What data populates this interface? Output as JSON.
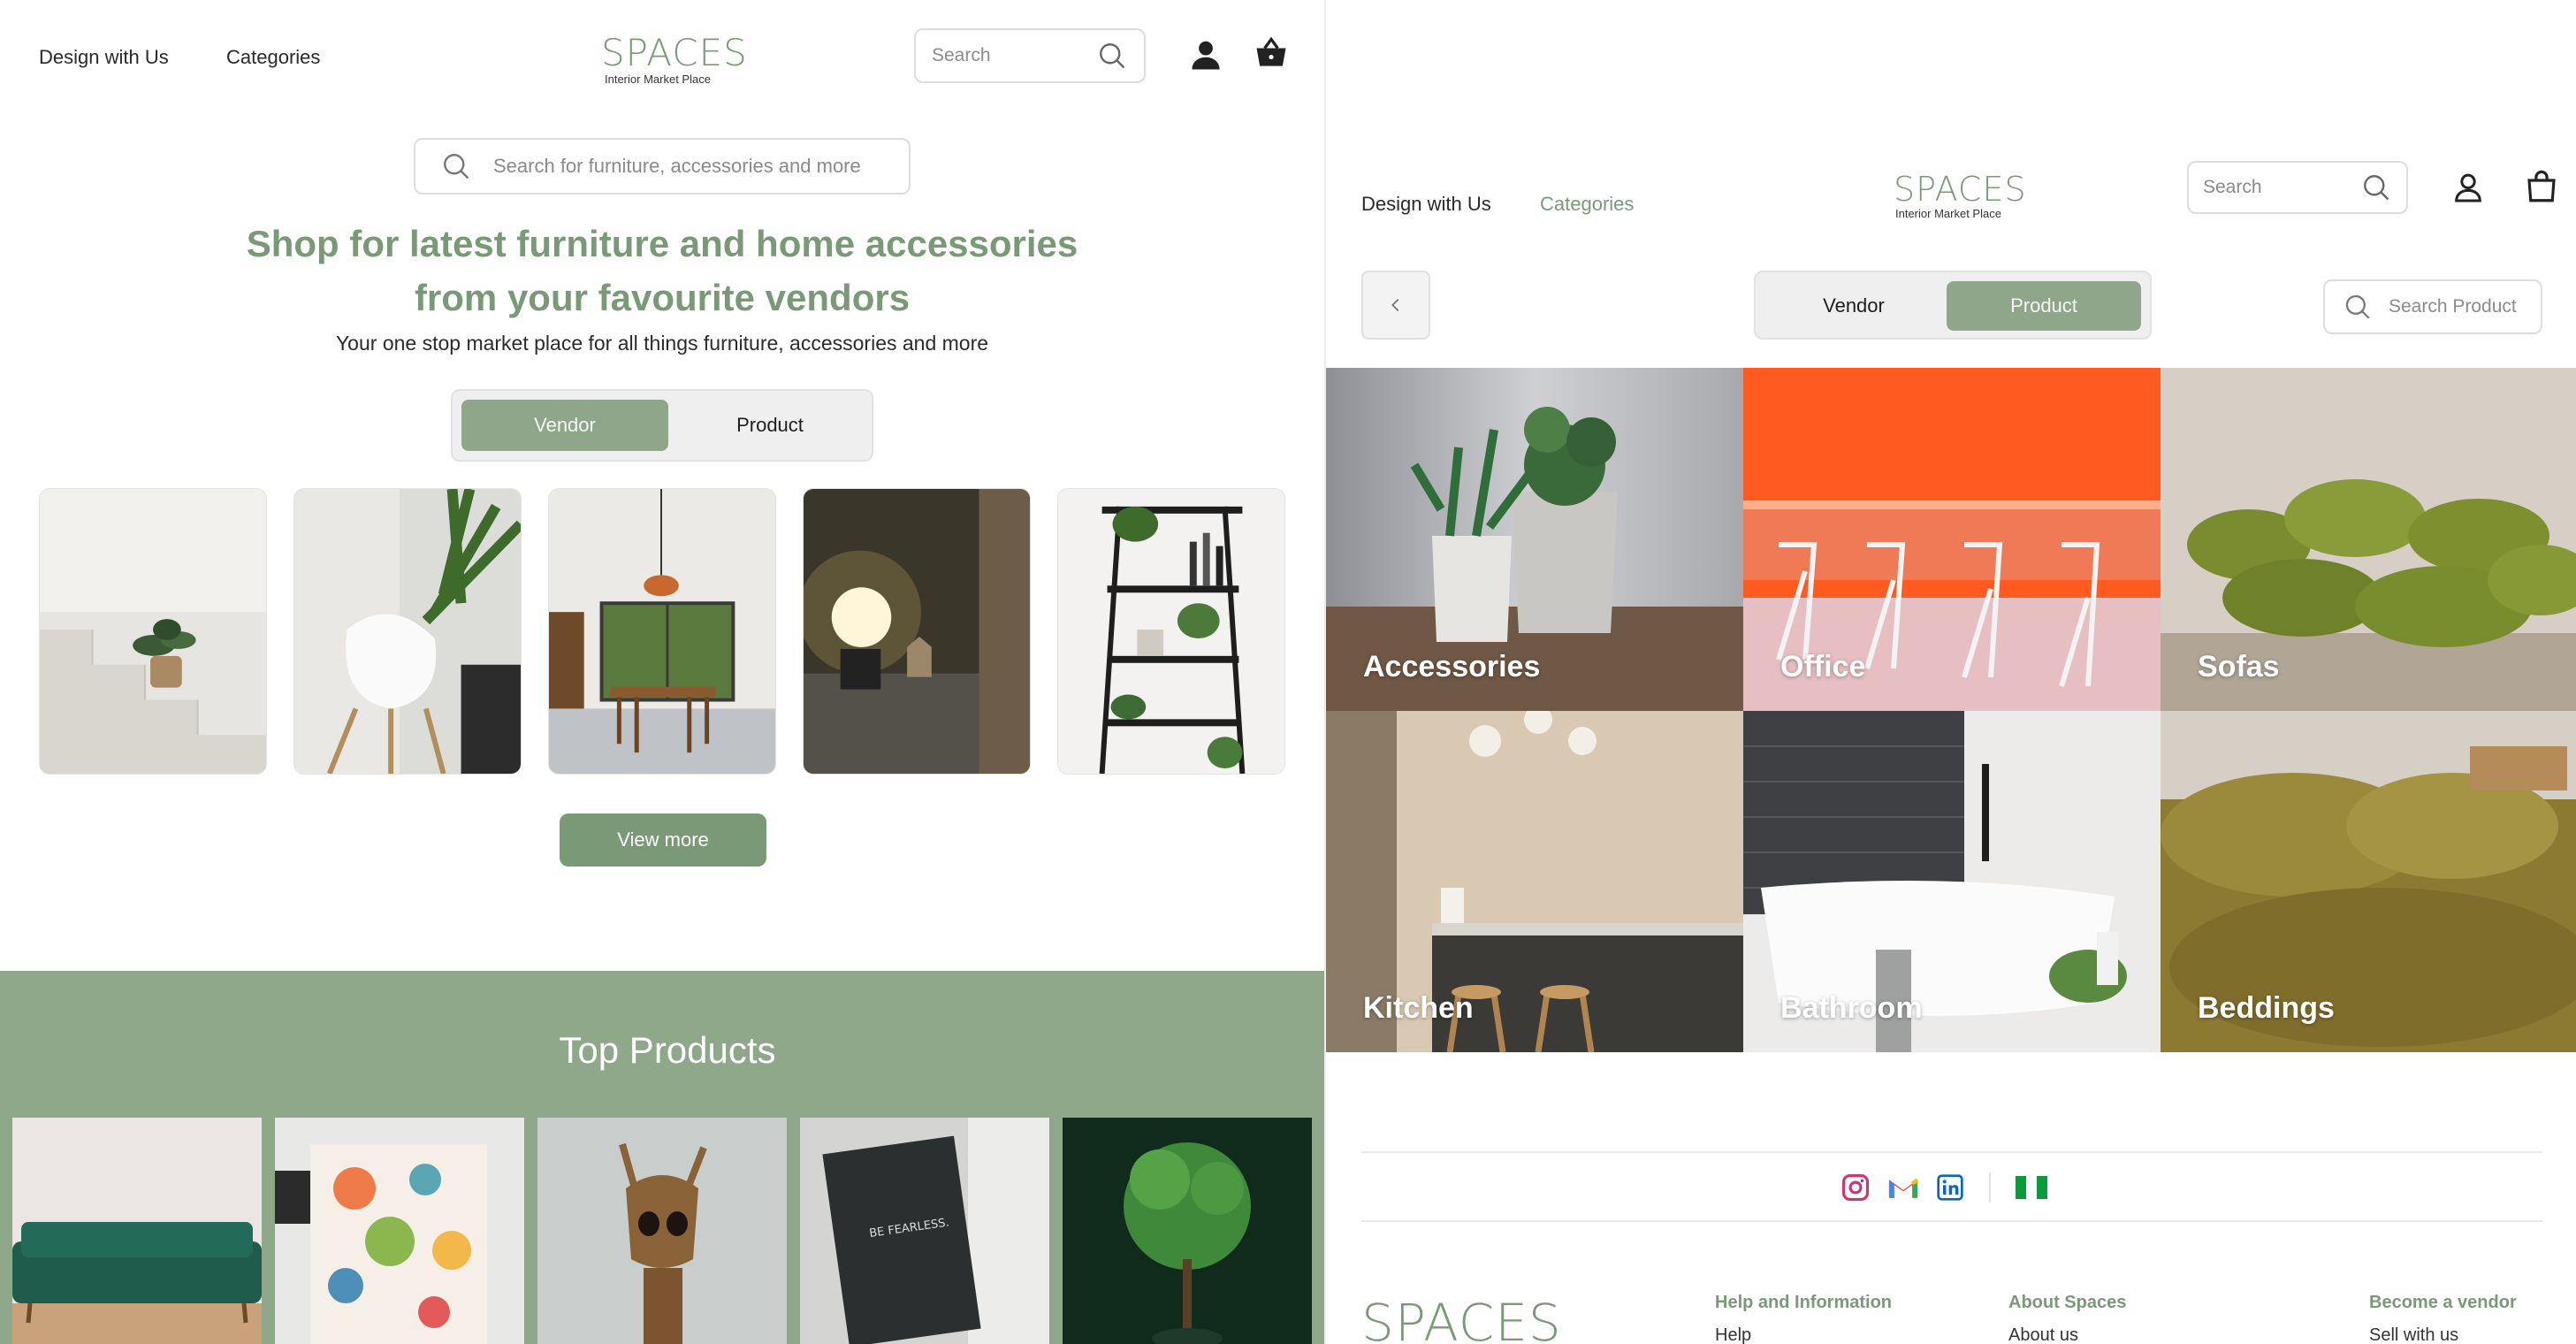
{
  "left": {
    "nav": {
      "design_with_us": "Design with Us",
      "categories": "Categories"
    },
    "logo": {
      "word": "SPACES",
      "tagline": "Interior Market Place"
    },
    "header_search": {
      "placeholder": "Search"
    },
    "hero_search": {
      "placeholder": "Search for furniture, accessories and more"
    },
    "hero": {
      "title_line1": "Shop for latest furniture and home accessories",
      "title_line2": "from your favourite vendors",
      "subtitle": "Your one stop market place for all things furniture, accessories and more"
    },
    "toggle": {
      "vendor": "Vendor",
      "product": "Product",
      "selected": "Vendor"
    },
    "view_more": "View more",
    "top_products": {
      "title": "Top Products"
    }
  },
  "right": {
    "nav": {
      "design_with_us": "Design with Us",
      "categories": "Categories",
      "active": "Categories"
    },
    "logo": {
      "word": "SPACES",
      "tagline": "Interior Market Place"
    },
    "header_search": {
      "placeholder": "Search"
    },
    "toggle": {
      "vendor": "Vendor",
      "product": "Product",
      "selected": "Product"
    },
    "product_search": {
      "placeholder": "Search Product"
    },
    "categories": [
      {
        "label": "Accessories"
      },
      {
        "label": "Office"
      },
      {
        "label": "Sofas"
      },
      {
        "label": "Kitchen"
      },
      {
        "label": "Bathroom"
      },
      {
        "label": "Beddings"
      }
    ],
    "footer": {
      "logo": "SPACES",
      "social": [
        "instagram-icon",
        "gmail-icon",
        "linkedin-icon",
        "nigeria-flag-icon"
      ],
      "columns": [
        {
          "heading": "Help and Information",
          "first_link": "Help"
        },
        {
          "heading": "About Spaces",
          "first_link": "About us"
        },
        {
          "heading": "Become a vendor",
          "first_link": "Sell with us"
        }
      ]
    }
  },
  "colors": {
    "accent": "#7a9a77",
    "accent_light": "#8fa68a",
    "band": "#8fa88a",
    "orange": "#ff5a1f"
  }
}
